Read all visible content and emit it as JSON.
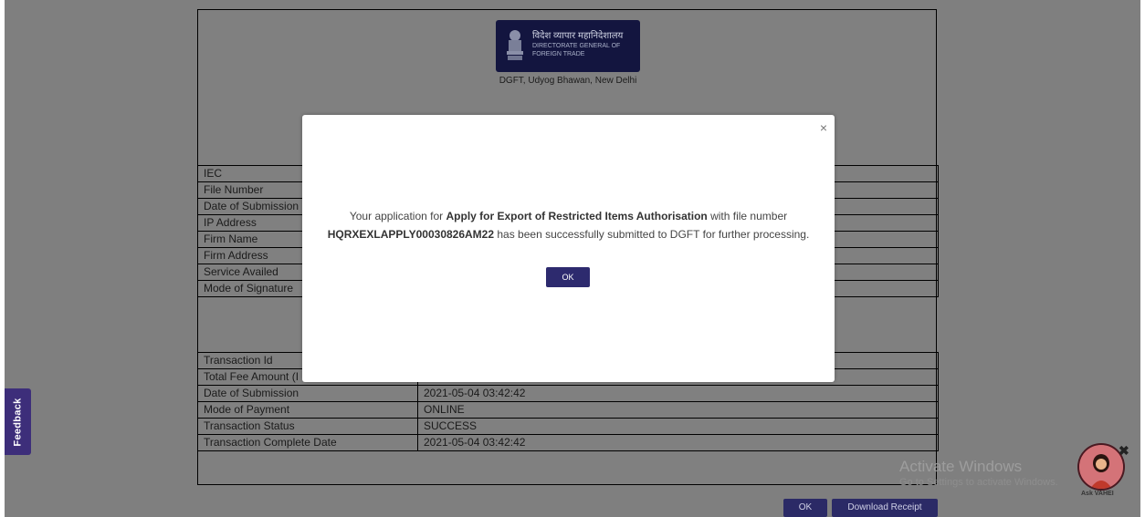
{
  "header": {
    "logo_hindi": "विदेश व्यापार महानिदेशालय",
    "logo_english_line1": "DIRECTORATE GENERAL OF",
    "logo_english_line2": "FOREIGN TRADE",
    "address": "DGFT, Udyog Bhawan, New Delhi"
  },
  "application_details": [
    {
      "label": "IEC",
      "value": ""
    },
    {
      "label": "File Number",
      "value": ""
    },
    {
      "label": "Date of Submission",
      "value": ""
    },
    {
      "label": "IP Address",
      "value": ""
    },
    {
      "label": "Firm Name",
      "value": ""
    },
    {
      "label": "Firm Address",
      "value": ""
    },
    {
      "label": "Service Availed",
      "value": ""
    },
    {
      "label": "Mode of Signature",
      "value": ""
    }
  ],
  "payment_details": [
    {
      "label": "Transaction Id",
      "value": ""
    },
    {
      "label": "Total Fee Amount (I",
      "value": ""
    },
    {
      "label": "Date of Submission",
      "value": "2021-05-04 03:42:42"
    },
    {
      "label": "Mode of Payment",
      "value": "ONLINE"
    },
    {
      "label": "Transaction Status",
      "value": "SUCCESS"
    },
    {
      "label": "Transaction Complete Date",
      "value": "2021-05-04 03:42:42"
    }
  ],
  "buttons": {
    "ok": "OK",
    "download_receipt": "Download Receipt"
  },
  "feedback_tab": "Feedback",
  "watermark": {
    "title": "Activate Windows",
    "subtitle": "Go to Settings to activate Windows."
  },
  "assistant": {
    "label": "Ask VAHEI",
    "close_symbol": "✖"
  },
  "modal": {
    "close_symbol": "×",
    "msg_prefix": "Your application for ",
    "service_name": "Apply for Export of Restricted Items Authorisation",
    "msg_middle": " with file number",
    "file_number": "HQRXEXLAPPLY00030826AM22",
    "msg_suffix": " has been successfully submitted to DGFT for further processing.",
    "ok_label": "OK"
  },
  "colors": {
    "overlay": "#7f7f7f",
    "button_primary": "#2d2a6e",
    "feedback_bg": "#3d2e7a"
  }
}
